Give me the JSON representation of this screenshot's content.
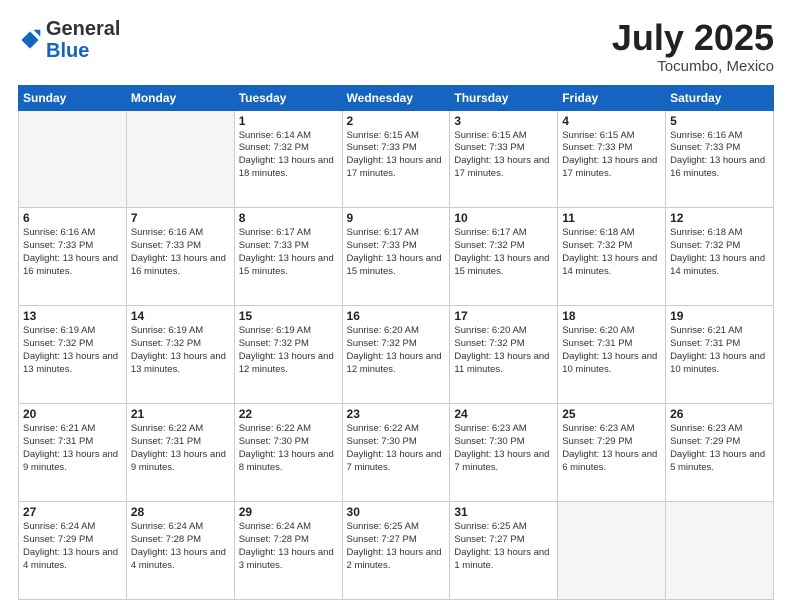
{
  "header": {
    "logo_general": "General",
    "logo_blue": "Blue",
    "month": "July 2025",
    "location": "Tocumbo, Mexico"
  },
  "weekdays": [
    "Sunday",
    "Monday",
    "Tuesday",
    "Wednesday",
    "Thursday",
    "Friday",
    "Saturday"
  ],
  "weeks": [
    [
      {
        "day": "",
        "info": ""
      },
      {
        "day": "",
        "info": ""
      },
      {
        "day": "1",
        "info": "Sunrise: 6:14 AM\nSunset: 7:32 PM\nDaylight: 13 hours and 18 minutes."
      },
      {
        "day": "2",
        "info": "Sunrise: 6:15 AM\nSunset: 7:33 PM\nDaylight: 13 hours and 17 minutes."
      },
      {
        "day": "3",
        "info": "Sunrise: 6:15 AM\nSunset: 7:33 PM\nDaylight: 13 hours and 17 minutes."
      },
      {
        "day": "4",
        "info": "Sunrise: 6:15 AM\nSunset: 7:33 PM\nDaylight: 13 hours and 17 minutes."
      },
      {
        "day": "5",
        "info": "Sunrise: 6:16 AM\nSunset: 7:33 PM\nDaylight: 13 hours and 16 minutes."
      }
    ],
    [
      {
        "day": "6",
        "info": "Sunrise: 6:16 AM\nSunset: 7:33 PM\nDaylight: 13 hours and 16 minutes."
      },
      {
        "day": "7",
        "info": "Sunrise: 6:16 AM\nSunset: 7:33 PM\nDaylight: 13 hours and 16 minutes."
      },
      {
        "day": "8",
        "info": "Sunrise: 6:17 AM\nSunset: 7:33 PM\nDaylight: 13 hours and 15 minutes."
      },
      {
        "day": "9",
        "info": "Sunrise: 6:17 AM\nSunset: 7:33 PM\nDaylight: 13 hours and 15 minutes."
      },
      {
        "day": "10",
        "info": "Sunrise: 6:17 AM\nSunset: 7:32 PM\nDaylight: 13 hours and 15 minutes."
      },
      {
        "day": "11",
        "info": "Sunrise: 6:18 AM\nSunset: 7:32 PM\nDaylight: 13 hours and 14 minutes."
      },
      {
        "day": "12",
        "info": "Sunrise: 6:18 AM\nSunset: 7:32 PM\nDaylight: 13 hours and 14 minutes."
      }
    ],
    [
      {
        "day": "13",
        "info": "Sunrise: 6:19 AM\nSunset: 7:32 PM\nDaylight: 13 hours and 13 minutes."
      },
      {
        "day": "14",
        "info": "Sunrise: 6:19 AM\nSunset: 7:32 PM\nDaylight: 13 hours and 13 minutes."
      },
      {
        "day": "15",
        "info": "Sunrise: 6:19 AM\nSunset: 7:32 PM\nDaylight: 13 hours and 12 minutes."
      },
      {
        "day": "16",
        "info": "Sunrise: 6:20 AM\nSunset: 7:32 PM\nDaylight: 13 hours and 12 minutes."
      },
      {
        "day": "17",
        "info": "Sunrise: 6:20 AM\nSunset: 7:32 PM\nDaylight: 13 hours and 11 minutes."
      },
      {
        "day": "18",
        "info": "Sunrise: 6:20 AM\nSunset: 7:31 PM\nDaylight: 13 hours and 10 minutes."
      },
      {
        "day": "19",
        "info": "Sunrise: 6:21 AM\nSunset: 7:31 PM\nDaylight: 13 hours and 10 minutes."
      }
    ],
    [
      {
        "day": "20",
        "info": "Sunrise: 6:21 AM\nSunset: 7:31 PM\nDaylight: 13 hours and 9 minutes."
      },
      {
        "day": "21",
        "info": "Sunrise: 6:22 AM\nSunset: 7:31 PM\nDaylight: 13 hours and 9 minutes."
      },
      {
        "day": "22",
        "info": "Sunrise: 6:22 AM\nSunset: 7:30 PM\nDaylight: 13 hours and 8 minutes."
      },
      {
        "day": "23",
        "info": "Sunrise: 6:22 AM\nSunset: 7:30 PM\nDaylight: 13 hours and 7 minutes."
      },
      {
        "day": "24",
        "info": "Sunrise: 6:23 AM\nSunset: 7:30 PM\nDaylight: 13 hours and 7 minutes."
      },
      {
        "day": "25",
        "info": "Sunrise: 6:23 AM\nSunset: 7:29 PM\nDaylight: 13 hours and 6 minutes."
      },
      {
        "day": "26",
        "info": "Sunrise: 6:23 AM\nSunset: 7:29 PM\nDaylight: 13 hours and 5 minutes."
      }
    ],
    [
      {
        "day": "27",
        "info": "Sunrise: 6:24 AM\nSunset: 7:29 PM\nDaylight: 13 hours and 4 minutes."
      },
      {
        "day": "28",
        "info": "Sunrise: 6:24 AM\nSunset: 7:28 PM\nDaylight: 13 hours and 4 minutes."
      },
      {
        "day": "29",
        "info": "Sunrise: 6:24 AM\nSunset: 7:28 PM\nDaylight: 13 hours and 3 minutes."
      },
      {
        "day": "30",
        "info": "Sunrise: 6:25 AM\nSunset: 7:27 PM\nDaylight: 13 hours and 2 minutes."
      },
      {
        "day": "31",
        "info": "Sunrise: 6:25 AM\nSunset: 7:27 PM\nDaylight: 13 hours and 1 minute."
      },
      {
        "day": "",
        "info": ""
      },
      {
        "day": "",
        "info": ""
      }
    ]
  ]
}
